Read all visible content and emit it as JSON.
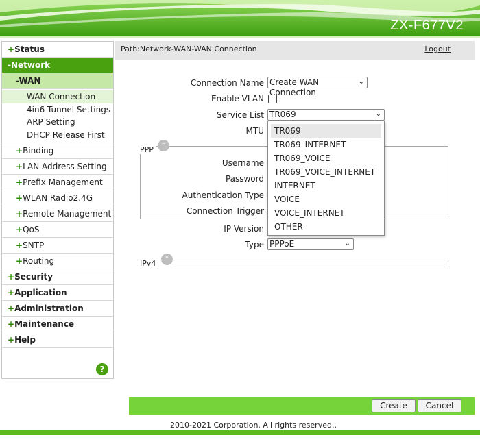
{
  "header": {
    "model": "ZX-F677V2"
  },
  "sidebar": {
    "status": "Status",
    "network": "-Network",
    "wan": "-WAN",
    "wan_items": [
      "WAN Connection",
      "4in6 Tunnel Settings",
      "ARP Setting",
      "DHCP Release First"
    ],
    "network_items": [
      "Binding",
      "LAN Address Setting",
      "Prefix Management",
      "WLAN Radio2.4G",
      "Remote Management",
      "QoS",
      "SNTP",
      "Routing"
    ],
    "top_items": [
      "Security",
      "Application",
      "Administration",
      "Maintenance",
      "Help"
    ],
    "help_icon": "?"
  },
  "pathbar": {
    "path": "Path:Network-WAN-WAN Connection",
    "logout": "Logout"
  },
  "form": {
    "connection_name_label": "Connection Name",
    "connection_name_value": "Create WAN Connection",
    "enable_vlan_label": "Enable VLAN",
    "service_list_label": "Service List",
    "service_list_value": "TR069",
    "mtu_label": "MTU",
    "ppp_title": "PPP",
    "username_label": "Username",
    "password_label": "Password",
    "auth_type_label": "Authentication Type",
    "conn_trigger_label": "Connection Trigger",
    "ip_version_label": "IP Version",
    "type_label": "Type",
    "type_value": "PPPoE",
    "ipv4_title": "IPv4"
  },
  "dropdown": {
    "options": [
      "TR069",
      "TR069_INTERNET",
      "TR069_VOICE",
      "TR069_VOICE_INTERNET",
      "INTERNET",
      "VOICE",
      "VOICE_INTERNET",
      "OTHER"
    ]
  },
  "actions": {
    "create": "Create",
    "cancel": "Cancel"
  },
  "footer": {
    "copyright": "2010-2021 Corporation. All rights reserved.."
  },
  "colors": {
    "brand_green": "#5dba1c",
    "nav_active": "#4aa10f",
    "action_bar": "#76d33a"
  }
}
